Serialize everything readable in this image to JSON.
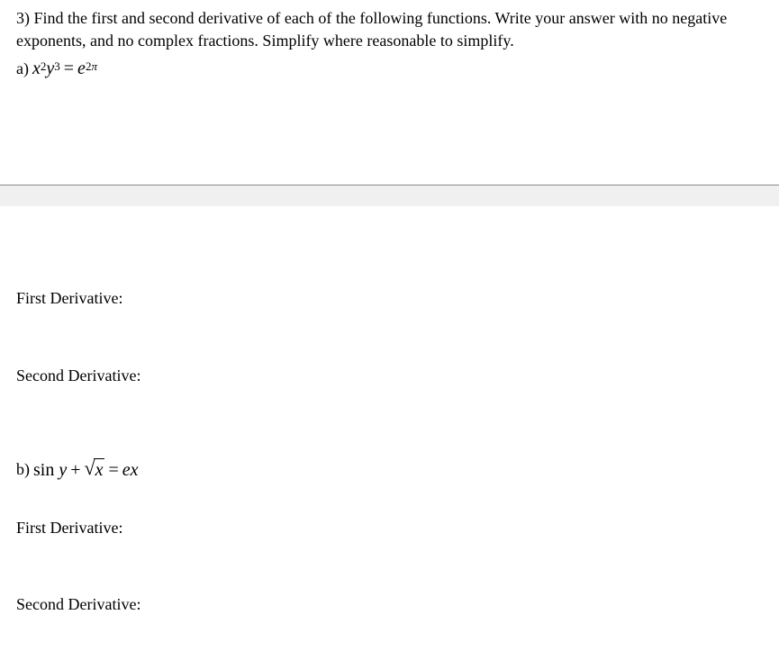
{
  "question": {
    "number": "3)",
    "text": "Find the first and second derivative of each of the following functions. Write your answer with no negative exponents, and no complex fractions. Simplify where reasonable to simplify."
  },
  "partA": {
    "label": "a)",
    "equation": {
      "x_var": "x",
      "x_exp": "2",
      "y_var": "y",
      "y_exp": "3",
      "equals": "=",
      "e_var": "e",
      "e_exp_coef": "2",
      "e_exp_sym": "π"
    },
    "firstDerivLabel": "First Derivative:",
    "secondDerivLabel": "Second Derivative:"
  },
  "partB": {
    "label": "b)",
    "equation": {
      "sin": "sin",
      "y_var": "y",
      "plus": "+",
      "sqrt_var": "x",
      "equals": "=",
      "e_var": "e",
      "x_var": "x"
    },
    "firstDerivLabel": "First Derivative:",
    "secondDerivLabel": "Second Derivative:"
  }
}
